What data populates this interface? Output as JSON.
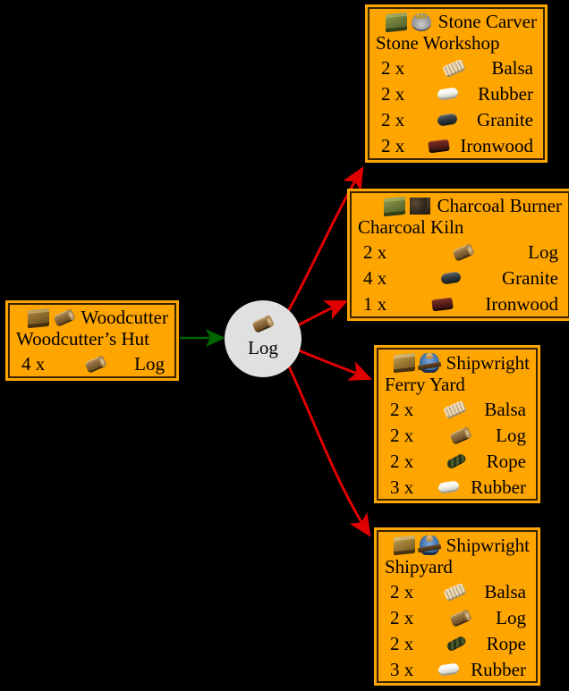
{
  "graph": {
    "background_color": "#000000",
    "box_fill": "#FFA500",
    "box_border": "#3a2300",
    "node_fill": "#e0e0e0",
    "producer_edge_color": "#006400",
    "consumer_edge_color": "#e00000"
  },
  "resource_node": {
    "label": "Log",
    "icon": "log-icon"
  },
  "producers": [
    {
      "id": "woodcutter",
      "worker": "Woodcutter",
      "building": "Woodcutter’s Hut",
      "building_icon": "building-icon",
      "worker_icon": "axe-icon",
      "outputs": [
        {
          "qty": "4 x",
          "icon": "log-icon",
          "name": "Log"
        }
      ]
    }
  ],
  "consumers": [
    {
      "id": "stone-workshop",
      "worker": "Stone Carver",
      "building": "Stone Workshop",
      "building_icon": "building-icon",
      "worker_icon": "stone-carver-icon",
      "inputs": [
        {
          "qty": "2 x",
          "icon": "balsa-icon",
          "name": "Balsa"
        },
        {
          "qty": "2 x",
          "icon": "rubber-icon",
          "name": "Rubber"
        },
        {
          "qty": "2 x",
          "icon": "granite-icon",
          "name": "Granite"
        },
        {
          "qty": "2 x",
          "icon": "ironwood-icon",
          "name": "Ironwood"
        }
      ]
    },
    {
      "id": "charcoal-kiln",
      "worker": "Charcoal Burner",
      "building": "Charcoal Kiln",
      "building_icon": "building-icon",
      "worker_icon": "charcoal-icon",
      "inputs": [
        {
          "qty": "2 x",
          "icon": "log-icon",
          "name": "Log"
        },
        {
          "qty": "4 x",
          "icon": "granite-icon",
          "name": "Granite"
        },
        {
          "qty": "1 x",
          "icon": "ironwood-icon",
          "name": "Ironwood"
        }
      ]
    },
    {
      "id": "ferry-yard",
      "worker": "Shipwright",
      "building": "Ferry Yard",
      "building_icon": "building-icon",
      "worker_icon": "shipwright-icon",
      "inputs": [
        {
          "qty": "2 x",
          "icon": "balsa-icon",
          "name": "Balsa"
        },
        {
          "qty": "2 x",
          "icon": "log-icon",
          "name": "Log"
        },
        {
          "qty": "2 x",
          "icon": "rope-icon",
          "name": "Rope"
        },
        {
          "qty": "3 x",
          "icon": "rubber-icon",
          "name": "Rubber"
        }
      ]
    },
    {
      "id": "shipyard",
      "worker": "Shipwright",
      "building": "Shipyard",
      "building_icon": "building-icon",
      "worker_icon": "shipwright-icon",
      "inputs": [
        {
          "qty": "2 x",
          "icon": "balsa-icon",
          "name": "Balsa"
        },
        {
          "qty": "2 x",
          "icon": "log-icon",
          "name": "Log"
        },
        {
          "qty": "2 x",
          "icon": "rope-icon",
          "name": "Rope"
        },
        {
          "qty": "3 x",
          "icon": "rubber-icon",
          "name": "Rubber"
        }
      ]
    }
  ]
}
